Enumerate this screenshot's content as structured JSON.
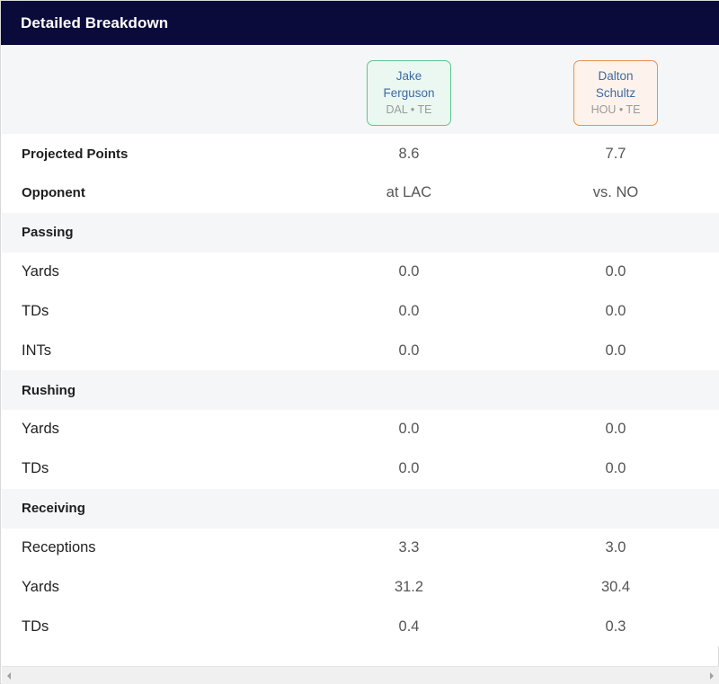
{
  "header": {
    "title": "Detailed Breakdown"
  },
  "players": [
    {
      "first": "Jake",
      "last": "Ferguson",
      "meta": "DAL • TE",
      "accent": "#5cc88f"
    },
    {
      "first": "Dalton",
      "last": "Schultz",
      "meta": "HOU • TE",
      "accent": "#e9934f"
    }
  ],
  "rows": [
    {
      "label": "Projected Points",
      "type": "summary",
      "values": [
        "8.6",
        "7.7"
      ]
    },
    {
      "label": "Opponent",
      "type": "summary",
      "values": [
        "at LAC",
        "vs. NO"
      ]
    },
    {
      "label": "Passing",
      "type": "section",
      "values": []
    },
    {
      "label": "Yards",
      "type": "stat",
      "values": [
        "0.0",
        "0.0"
      ]
    },
    {
      "label": "TDs",
      "type": "stat",
      "values": [
        "0.0",
        "0.0"
      ]
    },
    {
      "label": "INTs",
      "type": "stat",
      "values": [
        "0.0",
        "0.0"
      ]
    },
    {
      "label": "Rushing",
      "type": "section",
      "values": []
    },
    {
      "label": "Yards",
      "type": "stat",
      "values": [
        "0.0",
        "0.0"
      ]
    },
    {
      "label": "TDs",
      "type": "stat",
      "values": [
        "0.0",
        "0.0"
      ]
    },
    {
      "label": "Receiving",
      "type": "section",
      "values": []
    },
    {
      "label": "Receptions",
      "type": "stat",
      "values": [
        "3.3",
        "3.0"
      ]
    },
    {
      "label": "Yards",
      "type": "stat",
      "values": [
        "31.2",
        "30.4"
      ]
    },
    {
      "label": "TDs",
      "type": "stat",
      "values": [
        "0.4",
        "0.3"
      ]
    }
  ],
  "scrollbar": {
    "left_icon": "scroll-left-arrow",
    "right_icon": "scroll-right-arrow"
  }
}
